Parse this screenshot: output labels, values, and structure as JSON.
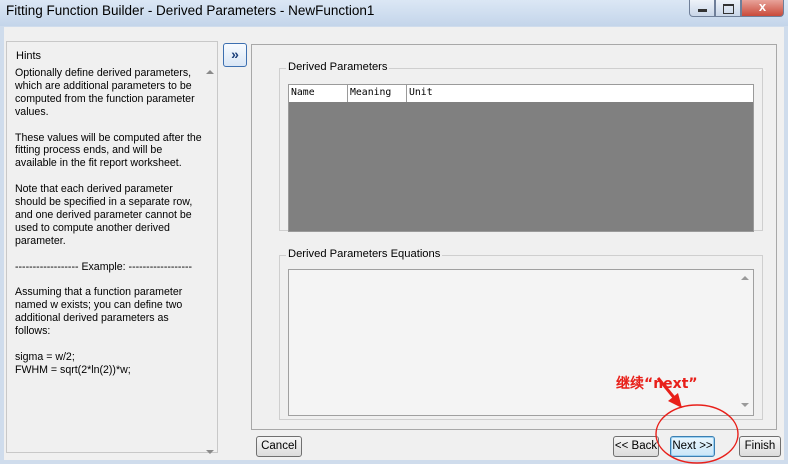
{
  "window": {
    "title": "Fitting Function Builder - Derived Parameters - NewFunction1",
    "close_glyph": "x"
  },
  "hints": {
    "title": "Hints",
    "paragraphs": [
      "Optionally define derived parameters, which are additional parameters to be computed from the function parameter values.",
      "These values will be computed after the fitting process ends, and will be available in the fit report worksheet.",
      "Note that each derived parameter should be specified in a separate row, and one derived parameter cannot be used to compute another derived parameter.",
      "------------------ Example: ------------------",
      "Assuming that a function parameter named w exists; you can define two additional derived parameters as follows:"
    ],
    "equations": [
      "sigma = w/2;",
      "FWHM = sqrt(2*ln(2))*w;"
    ]
  },
  "expand_button": {
    "label": "»"
  },
  "derived_parameters": {
    "title": "Derived Parameters",
    "columns": [
      "Name",
      "Meaning",
      "Unit"
    ]
  },
  "equations_group": {
    "title": "Derived Parameters Equations"
  },
  "buttons": {
    "cancel": "Cancel",
    "back": "<< Back",
    "next": "Next >>",
    "finish": "Finish"
  },
  "annotation": {
    "text": "继续“next”",
    "color": "#e8201a"
  }
}
